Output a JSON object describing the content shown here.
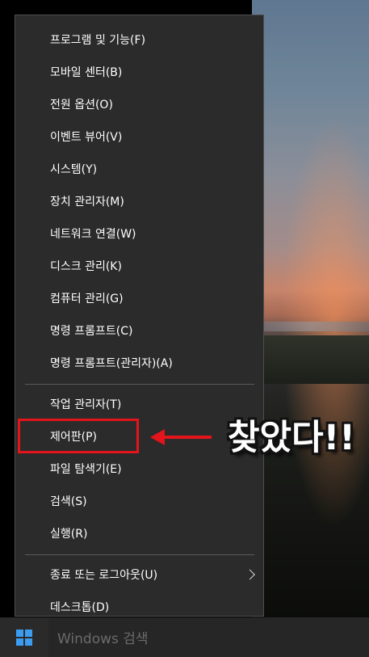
{
  "menu": {
    "items": [
      {
        "label": "프로그램 및 기능(F)"
      },
      {
        "label": "모바일 센터(B)"
      },
      {
        "label": "전원 옵션(O)"
      },
      {
        "label": "이벤트 뷰어(V)"
      },
      {
        "label": "시스템(Y)"
      },
      {
        "label": "장치 관리자(M)"
      },
      {
        "label": "네트워크 연결(W)"
      },
      {
        "label": "디스크 관리(K)"
      },
      {
        "label": "컴퓨터 관리(G)"
      },
      {
        "label": "명령 프롬프트(C)"
      },
      {
        "label": "명령 프롬프트(관리자)(A)"
      },
      {
        "label": "작업 관리자(T)"
      },
      {
        "label": "제어판(P)",
        "highlighted": true
      },
      {
        "label": "파일 탐색기(E)"
      },
      {
        "label": "검색(S)"
      },
      {
        "label": "실행(R)"
      },
      {
        "label": "종료 또는 로그아웃(U)",
        "submenu": true
      },
      {
        "label": "데스크톱(D)"
      }
    ]
  },
  "taskbar": {
    "search_placeholder": "Windows 검색",
    "start_icon": "windows-logo-icon"
  },
  "annotation": {
    "callout_text": "찾았다!!",
    "arrow_icon": "left-arrow-icon",
    "color": "#e3141b"
  }
}
